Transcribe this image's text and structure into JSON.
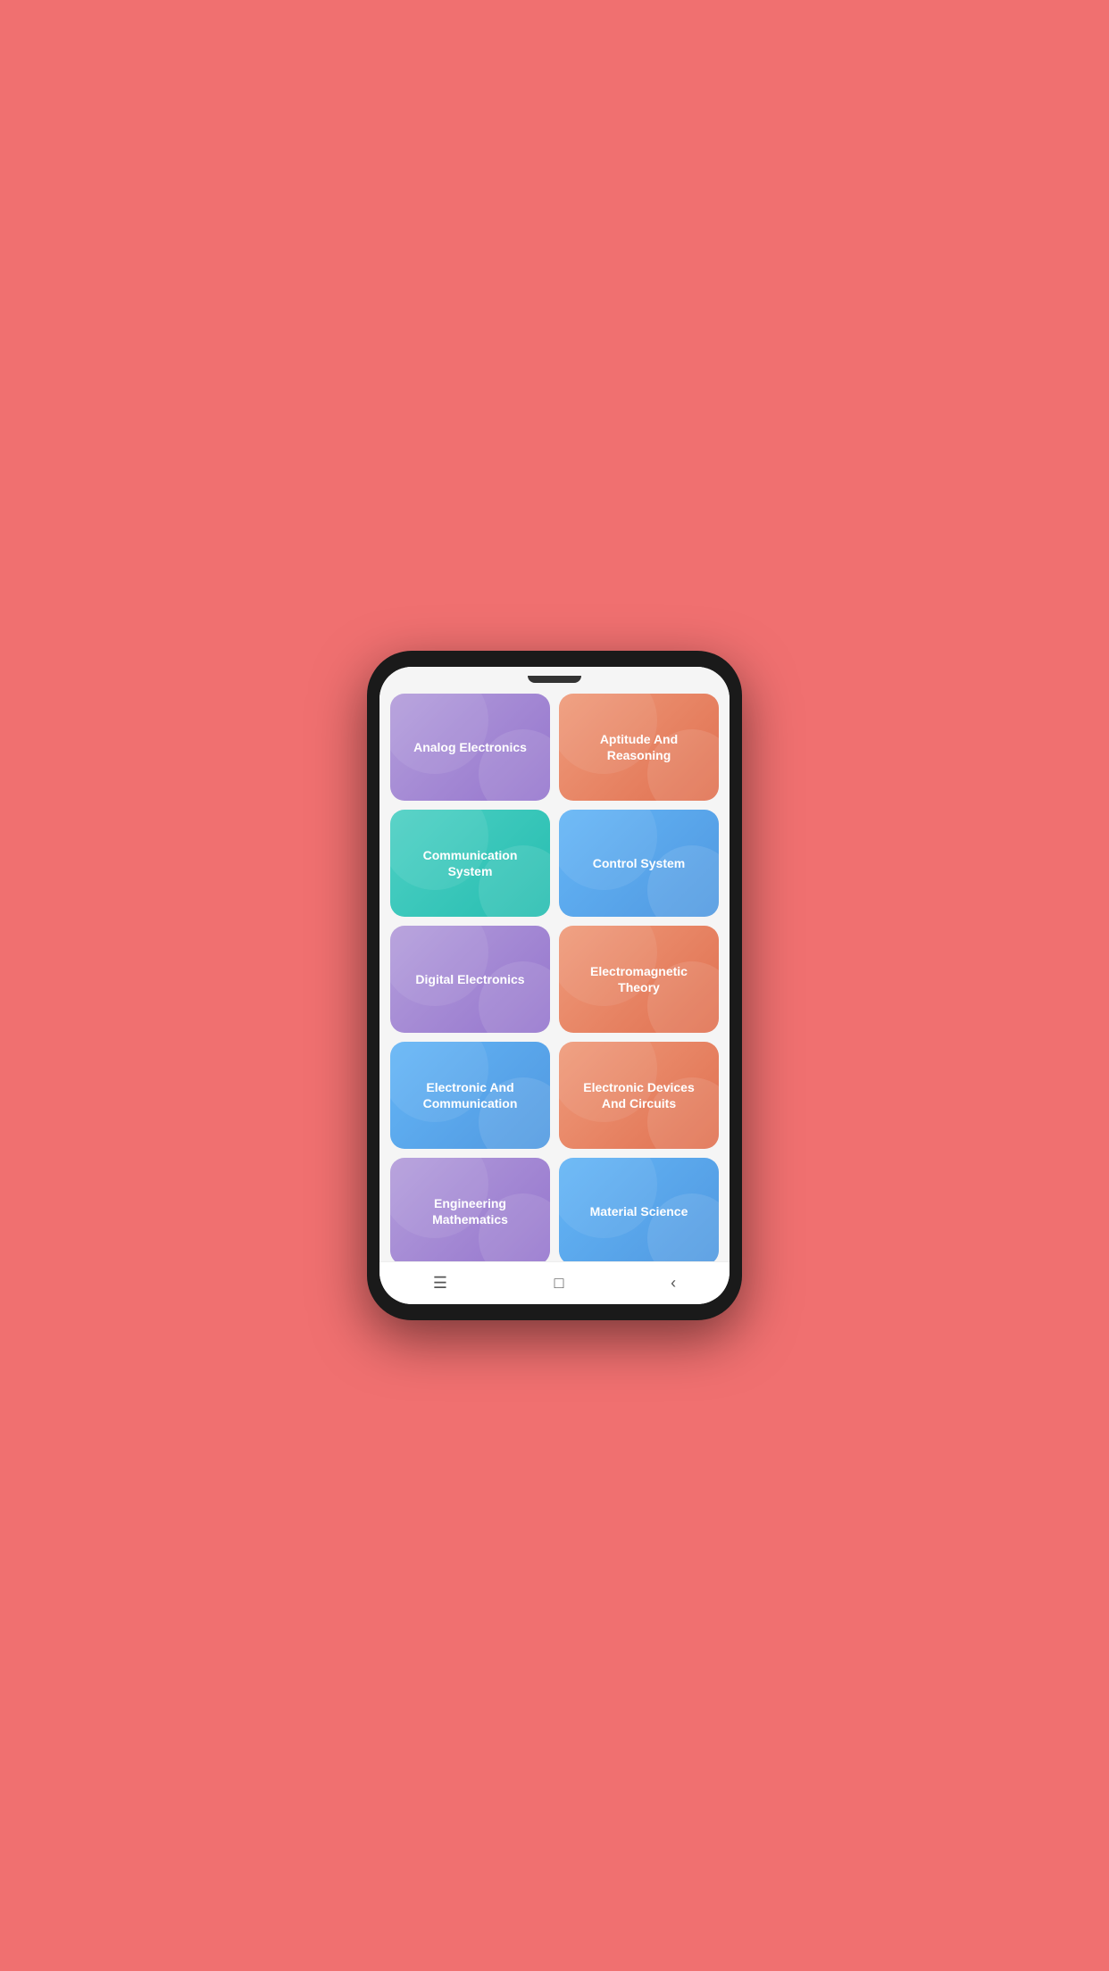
{
  "cards": [
    {
      "id": "analog-electronics",
      "label": "Analog Electronics",
      "color": "purple"
    },
    {
      "id": "aptitude-and-reasoning",
      "label": "Aptitude And Reasoning",
      "color": "orange"
    },
    {
      "id": "communication-system",
      "label": "Communication System",
      "color": "teal"
    },
    {
      "id": "control-system",
      "label": "Control System",
      "color": "blue"
    },
    {
      "id": "digital-electronics",
      "label": "Digital Electronics",
      "color": "purple"
    },
    {
      "id": "electromagnetic-theory",
      "label": "Electromagnetic Theory",
      "color": "orange"
    },
    {
      "id": "electronic-and-comm",
      "label": "Electronic And Communication",
      "color": "blue"
    },
    {
      "id": "electronic-devices",
      "label": "Electronic Devices And Circuits",
      "color": "orange"
    },
    {
      "id": "engineering-mathematics",
      "label": "Engineering Mathematics",
      "color": "purple"
    },
    {
      "id": "material-science",
      "label": "Material Science",
      "color": "blue"
    },
    {
      "id": "partial-left",
      "label": "",
      "color": "teal"
    },
    {
      "id": "partial-right",
      "label": "",
      "color": "orange"
    }
  ],
  "nav": {
    "menu_icon": "☰",
    "square_icon": "□",
    "back_icon": "‹"
  }
}
